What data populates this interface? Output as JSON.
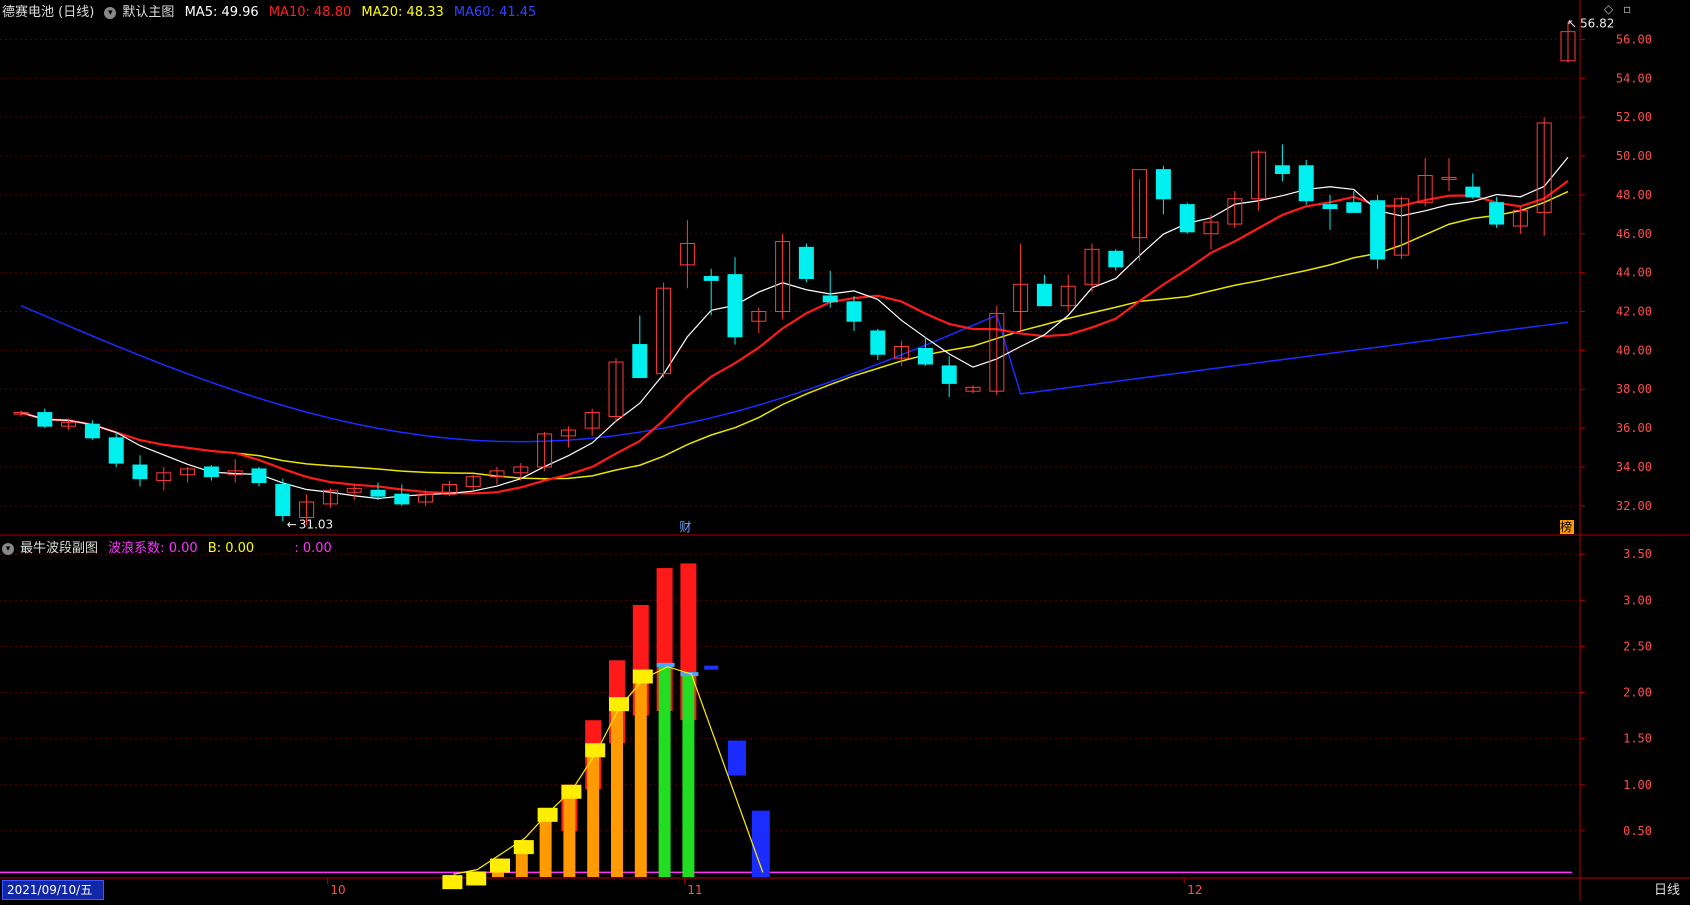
{
  "main_panel": {
    "stock_name": "德赛电池 (日线)",
    "template": "默认主图",
    "ma5": {
      "label": "MA5:",
      "value": "49.96",
      "color": "#ffffff"
    },
    "ma10": {
      "label": "MA10:",
      "value": "48.80",
      "color": "#ff2020"
    },
    "ma20": {
      "label": "MA20:",
      "value": "48.33",
      "color": "#ffff00"
    },
    "ma60": {
      "label": "MA60:",
      "value": "41.45",
      "color": "#2233ff"
    },
    "high_marker": "56.82",
    "low_marker": "31.03",
    "event_caifu": "财",
    "event_bang": "榜",
    "y_ticks": [
      "56.00",
      "54.00",
      "52.00",
      "50.00",
      "48.00",
      "46.00",
      "44.00",
      "42.00",
      "40.00",
      "38.00",
      "36.00",
      "34.00",
      "32.00"
    ]
  },
  "sub_panel": {
    "title": "最牛波段副图",
    "wave_label": "波浪系数:",
    "wave_value": "0.00",
    "b_label": "B:",
    "b_value": "0.00",
    "extra_label": ":",
    "extra_value": "0.00",
    "y_ticks": [
      "3.50",
      "3.00",
      "2.50",
      "2.00",
      "1.50",
      "1.00",
      "0.50"
    ]
  },
  "x_axis": {
    "date": "2021/09/10/五",
    "months": [
      "10",
      "11",
      "12"
    ],
    "cycle": "日线"
  },
  "window_icons": [
    "◇",
    "▫"
  ],
  "colors": {
    "up": "#ff3b3b",
    "down": "#00f0f0",
    "ma5": "#ffffff",
    "ma10": "#ff1a1a",
    "ma20": "#e6e600",
    "ma60": "#1a2cff",
    "grid": "#5a0000",
    "sep": "#b00000"
  },
  "chart_data": {
    "type": "candlestick",
    "price_range": [
      30.5,
      57.0
    ],
    "candles": [
      [
        36.8,
        36.9,
        36.6,
        36.8
      ],
      [
        36.8,
        37.0,
        36.0,
        36.1
      ],
      [
        36.1,
        36.5,
        35.9,
        36.3
      ],
      [
        36.2,
        36.4,
        35.4,
        35.5
      ],
      [
        35.5,
        35.8,
        34.0,
        34.2
      ],
      [
        34.1,
        34.6,
        33.0,
        33.4
      ],
      [
        33.3,
        34.0,
        32.8,
        33.7
      ],
      [
        33.6,
        34.0,
        33.2,
        33.9
      ],
      [
        34.0,
        34.1,
        33.3,
        33.5
      ],
      [
        33.6,
        34.4,
        33.2,
        33.8
      ],
      [
        33.9,
        34.0,
        33.0,
        33.2
      ],
      [
        33.1,
        33.4,
        31.2,
        31.5
      ],
      [
        31.4,
        32.6,
        31.0,
        32.2
      ],
      [
        32.1,
        32.9,
        31.9,
        32.8
      ],
      [
        32.7,
        33.1,
        32.3,
        32.9
      ],
      [
        32.8,
        33.2,
        32.3,
        32.5
      ],
      [
        32.6,
        33.1,
        32.0,
        32.1
      ],
      [
        32.2,
        32.8,
        32.0,
        32.6
      ],
      [
        32.6,
        33.3,
        32.5,
        33.1
      ],
      [
        33.0,
        33.6,
        32.8,
        33.5
      ],
      [
        33.5,
        34.0,
        33.1,
        33.8
      ],
      [
        33.7,
        34.2,
        33.3,
        34.0
      ],
      [
        34.0,
        35.8,
        33.8,
        35.7
      ],
      [
        35.6,
        36.1,
        35.0,
        35.9
      ],
      [
        36.0,
        37.0,
        35.6,
        36.8
      ],
      [
        36.6,
        39.6,
        36.3,
        39.4
      ],
      [
        40.3,
        41.8,
        38.6,
        38.6
      ],
      [
        38.8,
        43.5,
        38.6,
        43.2
      ],
      [
        44.4,
        46.7,
        43.2,
        45.5
      ],
      [
        43.8,
        44.2,
        41.8,
        43.6
      ],
      [
        43.9,
        44.8,
        40.3,
        40.7
      ],
      [
        41.5,
        42.2,
        40.9,
        42.0
      ],
      [
        42.0,
        46.0,
        41.6,
        45.6
      ],
      [
        45.3,
        45.5,
        43.5,
        43.7
      ],
      [
        42.8,
        44.1,
        42.2,
        42.5
      ],
      [
        42.5,
        42.8,
        41.0,
        41.5
      ],
      [
        41.0,
        41.1,
        39.5,
        39.8
      ],
      [
        39.6,
        40.5,
        39.2,
        40.2
      ],
      [
        40.1,
        40.7,
        39.2,
        39.3
      ],
      [
        39.2,
        39.7,
        37.6,
        38.3
      ],
      [
        37.9,
        38.2,
        37.8,
        38.1
      ],
      [
        37.9,
        42.3,
        37.7,
        41.9
      ],
      [
        42.0,
        45.5,
        41.0,
        43.4
      ],
      [
        43.4,
        43.9,
        42.3,
        42.3
      ],
      [
        42.3,
        43.9,
        42.0,
        43.3
      ],
      [
        43.4,
        45.5,
        43.0,
        45.2
      ],
      [
        45.1,
        45.2,
        44.1,
        44.3
      ],
      [
        45.8,
        48.8,
        44.6,
        49.3
      ],
      [
        49.3,
        49.5,
        47.0,
        47.8
      ],
      [
        47.5,
        47.6,
        46.0,
        46.1
      ],
      [
        46.0,
        47.0,
        45.2,
        46.6
      ],
      [
        46.5,
        48.2,
        46.3,
        47.8
      ],
      [
        47.8,
        50.3,
        47.2,
        50.2
      ],
      [
        49.5,
        50.6,
        48.7,
        49.1
      ],
      [
        49.5,
        49.8,
        47.5,
        47.7
      ],
      [
        47.5,
        48.0,
        46.2,
        47.3
      ],
      [
        47.6,
        48.2,
        47.1,
        47.1
      ],
      [
        47.7,
        48.0,
        44.2,
        44.7
      ],
      [
        44.9,
        47.9,
        44.7,
        47.8
      ],
      [
        47.6,
        49.9,
        47.4,
        49.0
      ],
      [
        48.8,
        49.9,
        48.2,
        48.9
      ],
      [
        48.4,
        49.1,
        47.8,
        47.9
      ],
      [
        47.6,
        47.9,
        46.3,
        46.5
      ],
      [
        46.4,
        47.4,
        46.0,
        47.2
      ],
      [
        47.1,
        52.0,
        45.9,
        51.7
      ],
      [
        54.9,
        56.9,
        54.8,
        56.4
      ]
    ],
    "ma5_last": 49.96,
    "ma10_last": 48.8,
    "ma20_last": 48.33,
    "ma60_last": 41.45,
    "sub_range": [
      0,
      3.6
    ],
    "sub_bars": [
      {
        "i": 18,
        "top": 0.02,
        "kind": "orange"
      },
      {
        "i": 19,
        "top": 0.06,
        "kind": "orange"
      },
      {
        "i": 20,
        "top": 0.2,
        "kind": "orange"
      },
      {
        "i": 21,
        "top": 0.4,
        "kind": "orange"
      },
      {
        "i": 22,
        "top": 0.75,
        "kind": "orange"
      },
      {
        "i": 23,
        "top": 1.0,
        "red": 1.0,
        "kind": "orange"
      },
      {
        "i": 24,
        "top": 1.45,
        "red": 1.7,
        "kind": "orange"
      },
      {
        "i": 25,
        "top": 1.95,
        "red": 2.35,
        "kind": "orange"
      },
      {
        "i": 26,
        "top": 2.25,
        "red": 2.95,
        "kind": "orange"
      },
      {
        "i": 27,
        "top": 2.3,
        "red": 3.35,
        "kind": "green"
      },
      {
        "i": 28,
        "top": 2.2,
        "red": 3.4,
        "kind": "green"
      },
      {
        "i": 29,
        "top": 2.27,
        "kind": "marker"
      },
      {
        "i": 30,
        "low": 1.1,
        "top": 1.48,
        "kind": "blue"
      },
      {
        "i": 31,
        "low": 0,
        "top": 0.72,
        "kind": "blue"
      }
    ]
  }
}
